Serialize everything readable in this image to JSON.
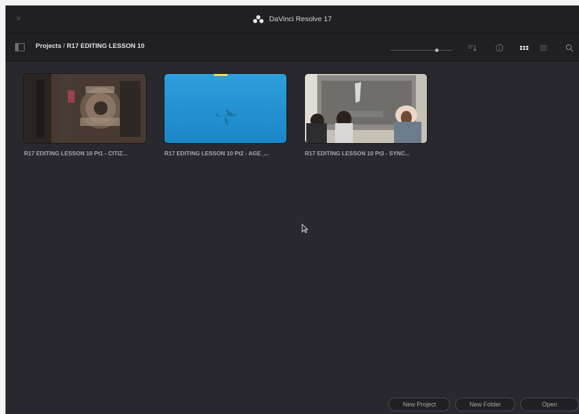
{
  "window": {
    "title": "DaVinci Resolve 17",
    "close_label": "×"
  },
  "toolbar": {
    "breadcrumb_root": "Projects",
    "breadcrumb_sep": " / ",
    "breadcrumb_current": "R17 EDITING LESSON 10",
    "zoom_level": 0.76,
    "view_mode": "grid"
  },
  "projects": [
    {
      "name": "R17 EDITING LESSON 10 Pt1 - CITIZ...",
      "thumbnail": "machinery-closeup"
    },
    {
      "name": "R17 EDITING LESSON 10 Pt2 - AGE_...",
      "thumbnail": "blue-sky-plane"
    },
    {
      "name": "R17 EDITING LESSON 10 Pt3 - SYNC...",
      "thumbnail": "summit-people"
    }
  ],
  "buttons": {
    "new_project": "New Project",
    "new_folder": "New Folder",
    "open": "Open"
  },
  "colors": {
    "background": "#28282e",
    "titlebar": "#1f1f24",
    "text": "#d7d7db",
    "muted": "#a7a7ad"
  }
}
